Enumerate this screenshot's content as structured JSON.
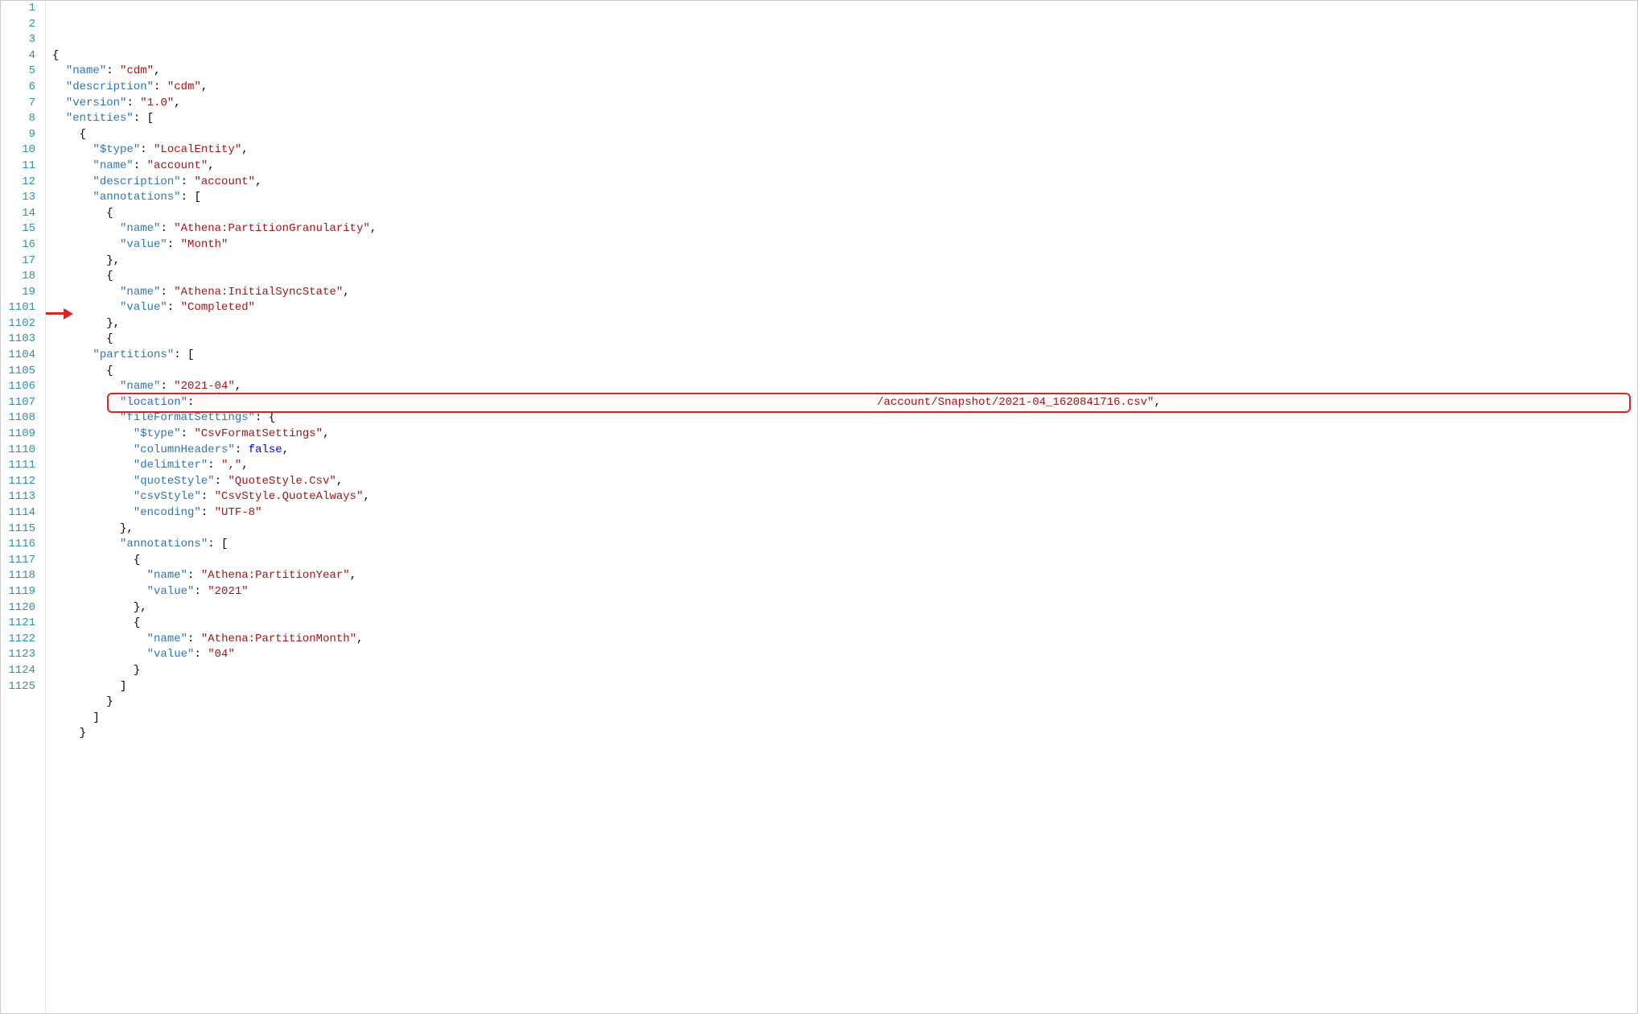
{
  "line_numbers": [
    "1",
    "2",
    "3",
    "4",
    "5",
    "6",
    "7",
    "8",
    "9",
    "10",
    "11",
    "12",
    "13",
    "14",
    "15",
    "16",
    "17",
    "18",
    "19",
    "1101",
    "1102",
    "1103",
    "1104",
    "1105",
    "1106",
    "1107",
    "1108",
    "1109",
    "1110",
    "1111",
    "1112",
    "1113",
    "1114",
    "1115",
    "1116",
    "1117",
    "1118",
    "1119",
    "1120",
    "1121",
    "1122",
    "1123",
    "1124",
    "1125"
  ],
  "lines": [
    [
      [
        "punc",
        "{"
      ]
    ],
    [
      [
        "sp",
        "  "
      ],
      [
        "key",
        "\"name\""
      ],
      [
        "punc",
        ": "
      ],
      [
        "str",
        "\"cdm\""
      ],
      [
        "punc",
        ","
      ]
    ],
    [
      [
        "sp",
        "  "
      ],
      [
        "key",
        "\"description\""
      ],
      [
        "punc",
        ": "
      ],
      [
        "str",
        "\"cdm\""
      ],
      [
        "punc",
        ","
      ]
    ],
    [
      [
        "sp",
        "  "
      ],
      [
        "key",
        "\"version\""
      ],
      [
        "punc",
        ": "
      ],
      [
        "str",
        "\"1.0\""
      ],
      [
        "punc",
        ","
      ]
    ],
    [
      [
        "sp",
        "  "
      ],
      [
        "key",
        "\"entities\""
      ],
      [
        "punc",
        ": ["
      ]
    ],
    [
      [
        "sp",
        "    "
      ],
      [
        "punc",
        "{"
      ]
    ],
    [
      [
        "sp",
        "      "
      ],
      [
        "key",
        "\"$type\""
      ],
      [
        "punc",
        ": "
      ],
      [
        "str",
        "\"LocalEntity\""
      ],
      [
        "punc",
        ","
      ]
    ],
    [
      [
        "sp",
        "      "
      ],
      [
        "key",
        "\"name\""
      ],
      [
        "punc",
        ": "
      ],
      [
        "str",
        "\"account\""
      ],
      [
        "punc",
        ","
      ]
    ],
    [
      [
        "sp",
        "      "
      ],
      [
        "key",
        "\"description\""
      ],
      [
        "punc",
        ": "
      ],
      [
        "str",
        "\"account\""
      ],
      [
        "punc",
        ","
      ]
    ],
    [
      [
        "sp",
        "      "
      ],
      [
        "key",
        "\"annotations\""
      ],
      [
        "punc",
        ": ["
      ]
    ],
    [
      [
        "sp",
        "        "
      ],
      [
        "punc",
        "{"
      ]
    ],
    [
      [
        "sp",
        "          "
      ],
      [
        "key",
        "\"name\""
      ],
      [
        "punc",
        ": "
      ],
      [
        "str",
        "\"Athena:PartitionGranularity\""
      ],
      [
        "punc",
        ","
      ]
    ],
    [
      [
        "sp",
        "          "
      ],
      [
        "key",
        "\"value\""
      ],
      [
        "punc",
        ": "
      ],
      [
        "str",
        "\"Month\""
      ]
    ],
    [
      [
        "sp",
        "        "
      ],
      [
        "punc",
        "},"
      ]
    ],
    [
      [
        "sp",
        "        "
      ],
      [
        "punc",
        "{"
      ]
    ],
    [
      [
        "sp",
        "          "
      ],
      [
        "key",
        "\"name\""
      ],
      [
        "punc",
        ": "
      ],
      [
        "str",
        "\"Athena:InitialSyncState\""
      ],
      [
        "punc",
        ","
      ]
    ],
    [
      [
        "sp",
        "          "
      ],
      [
        "key",
        "\"value\""
      ],
      [
        "punc",
        ": "
      ],
      [
        "str",
        "\"Completed\""
      ]
    ],
    [
      [
        "sp",
        "        "
      ],
      [
        "punc",
        "},"
      ]
    ],
    [
      [
        "sp",
        "        "
      ],
      [
        "punc",
        "{"
      ]
    ],
    [
      [
        "sp",
        "      "
      ],
      [
        "key",
        "\"partitions\""
      ],
      [
        "punc",
        ": ["
      ]
    ],
    [
      [
        "sp",
        "        "
      ],
      [
        "punc",
        "{"
      ]
    ],
    [
      [
        "sp",
        "          "
      ],
      [
        "key",
        "\"name\""
      ],
      [
        "punc",
        ": "
      ],
      [
        "str",
        "\"2021-04\""
      ],
      [
        "punc",
        ","
      ]
    ],
    [
      [
        "sp",
        "          "
      ],
      [
        "key",
        "\"location\""
      ],
      [
        "punc",
        ":                                                                                                     "
      ],
      [
        "str",
        "/account/Snapshot/2021-04_1620841716.csv\""
      ],
      [
        "punc",
        ","
      ]
    ],
    [
      [
        "sp",
        "          "
      ],
      [
        "key",
        "\"fileFormatSettings\""
      ],
      [
        "punc",
        ": {"
      ]
    ],
    [
      [
        "sp",
        "            "
      ],
      [
        "key",
        "\"$type\""
      ],
      [
        "punc",
        ": "
      ],
      [
        "str",
        "\"CsvFormatSettings\""
      ],
      [
        "punc",
        ","
      ]
    ],
    [
      [
        "sp",
        "            "
      ],
      [
        "key",
        "\"columnHeaders\""
      ],
      [
        "punc",
        ": "
      ],
      [
        "kw",
        "false"
      ],
      [
        "punc",
        ","
      ]
    ],
    [
      [
        "sp",
        "            "
      ],
      [
        "key",
        "\"delimiter\""
      ],
      [
        "punc",
        ": "
      ],
      [
        "str",
        "\",\""
      ],
      [
        "punc",
        ","
      ]
    ],
    [
      [
        "sp",
        "            "
      ],
      [
        "key",
        "\"quoteStyle\""
      ],
      [
        "punc",
        ": "
      ],
      [
        "str",
        "\"QuoteStyle.Csv\""
      ],
      [
        "punc",
        ","
      ]
    ],
    [
      [
        "sp",
        "            "
      ],
      [
        "key",
        "\"csvStyle\""
      ],
      [
        "punc",
        ": "
      ],
      [
        "str",
        "\"CsvStyle.QuoteAlways\""
      ],
      [
        "punc",
        ","
      ]
    ],
    [
      [
        "sp",
        "            "
      ],
      [
        "key",
        "\"encoding\""
      ],
      [
        "punc",
        ": "
      ],
      [
        "str",
        "\"UTF-8\""
      ]
    ],
    [
      [
        "sp",
        "          "
      ],
      [
        "punc",
        "},"
      ]
    ],
    [
      [
        "sp",
        "          "
      ],
      [
        "key",
        "\"annotations\""
      ],
      [
        "punc",
        ": ["
      ]
    ],
    [
      [
        "sp",
        "            "
      ],
      [
        "punc",
        "{"
      ]
    ],
    [
      [
        "sp",
        "              "
      ],
      [
        "key",
        "\"name\""
      ],
      [
        "punc",
        ": "
      ],
      [
        "str",
        "\"Athena:PartitionYear\""
      ],
      [
        "punc",
        ","
      ]
    ],
    [
      [
        "sp",
        "              "
      ],
      [
        "key",
        "\"value\""
      ],
      [
        "punc",
        ": "
      ],
      [
        "str",
        "\"2021\""
      ]
    ],
    [
      [
        "sp",
        "            "
      ],
      [
        "punc",
        "},"
      ]
    ],
    [
      [
        "sp",
        "            "
      ],
      [
        "punc",
        "{"
      ]
    ],
    [
      [
        "sp",
        "              "
      ],
      [
        "key",
        "\"name\""
      ],
      [
        "punc",
        ": "
      ],
      [
        "str",
        "\"Athena:PartitionMonth\""
      ],
      [
        "punc",
        ","
      ]
    ],
    [
      [
        "sp",
        "              "
      ],
      [
        "key",
        "\"value\""
      ],
      [
        "punc",
        ": "
      ],
      [
        "str",
        "\"04\""
      ]
    ],
    [
      [
        "sp",
        "            "
      ],
      [
        "punc",
        "}"
      ]
    ],
    [
      [
        "sp",
        "          "
      ],
      [
        "punc",
        "]"
      ]
    ],
    [
      [
        "sp",
        "        "
      ],
      [
        "punc",
        "}"
      ]
    ],
    [
      [
        "sp",
        "      "
      ],
      [
        "punc",
        "]"
      ]
    ],
    [
      [
        "sp",
        "    "
      ],
      [
        "punc",
        "}"
      ]
    ]
  ],
  "highlight": {
    "line_index": 22
  },
  "arrow_target_line_index": 19
}
